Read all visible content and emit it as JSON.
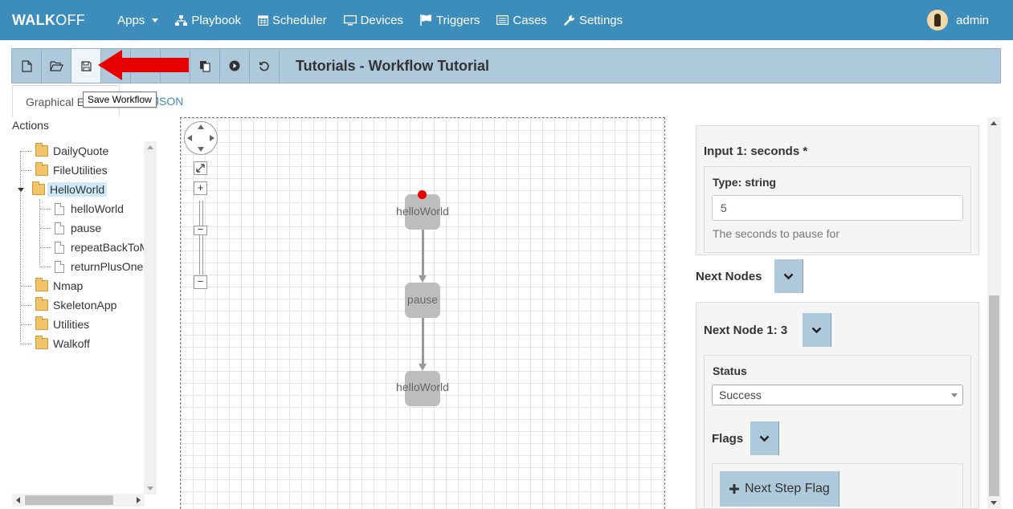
{
  "navbar": {
    "brand_bold": "WALK",
    "brand_rest": "OFF",
    "items": [
      {
        "label": "Apps",
        "icon": "dropdown-caret"
      },
      {
        "label": "Playbook",
        "icon": "sitemap-icon"
      },
      {
        "label": "Scheduler",
        "icon": "calendar-icon"
      },
      {
        "label": "Devices",
        "icon": "monitor-icon"
      },
      {
        "label": "Triggers",
        "icon": "flag-icon"
      },
      {
        "label": "Cases",
        "icon": "list-icon"
      },
      {
        "label": "Settings",
        "icon": "wrench-icon"
      }
    ],
    "user": "admin"
  },
  "toolbar": {
    "title": "Tutorials - Workflow Tutorial",
    "tooltip": "Save Workflow",
    "buttons": [
      "new-file-icon",
      "open-folder-icon",
      "save-icon",
      "copy-icon",
      "execute-icon",
      "undo-icon"
    ]
  },
  "tabs": {
    "graphical": "Graphical Editor",
    "json": "JSON"
  },
  "actions": {
    "heading": "Actions",
    "apps": [
      "DailyQuote",
      "FileUtilities",
      "HelloWorld",
      "Nmap",
      "SkeletonApp",
      "Utilities",
      "Walkoff"
    ],
    "helloworld_actions": [
      "helloWorld",
      "pause",
      "repeatBackToMe",
      "returnPlusOne"
    ]
  },
  "workflow": {
    "nodes": [
      "helloWorld",
      "pause",
      "helloWorld"
    ],
    "start_node": "helloWorld"
  },
  "properties": {
    "input_label": "Input 1: seconds *",
    "type_label": "Type: string",
    "input_value": "5",
    "input_help": "The seconds to pause for",
    "next_nodes_label": "Next Nodes",
    "next_node_label": "Next Node 1: 3",
    "status_label": "Status",
    "status_value": "Success",
    "flags_label": "Flags",
    "add_flag_label": "Next Step Flag"
  },
  "colors": {
    "navbar": "#3c8dbc",
    "toolbar": "#adc9db",
    "start_indicator": "#e60000",
    "annotation_arrow": "#e60000"
  }
}
